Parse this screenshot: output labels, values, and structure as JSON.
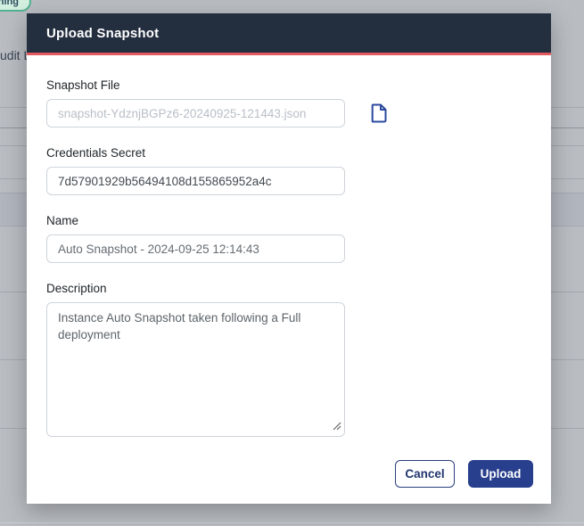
{
  "background": {
    "status_badge_label": "running",
    "clipped_nav_text": "udit L",
    "colors": {
      "overlay_gray": "#b9bdc2",
      "badge_bg": "#d2efe0",
      "badge_border": "#54b191"
    }
  },
  "modal": {
    "title": "Upload Snapshot",
    "fields": {
      "snapshot_file": {
        "label": "Snapshot File",
        "placeholder": "snapshot-YdznjBGPz6-20240925-121443.json"
      },
      "credentials_secret": {
        "label": "Credentials Secret",
        "value": "7d57901929b56494108d155865952a4c"
      },
      "name": {
        "label": "Name",
        "value": "Auto Snapshot - 2024-09-25 12:14:43"
      },
      "description": {
        "label": "Description",
        "value": "Instance Auto Snapshot taken following a Full deployment"
      }
    },
    "buttons": {
      "cancel": "Cancel",
      "upload": "Upload"
    },
    "icons": {
      "snapshot_file": "file-icon",
      "textarea_corner": "resize-grip-icon"
    },
    "colors": {
      "header_bg": "#232e3f",
      "header_accent": "#e25a5f",
      "primary_blue": "#283f8d",
      "icon_blue": "#2b4aa0"
    }
  }
}
